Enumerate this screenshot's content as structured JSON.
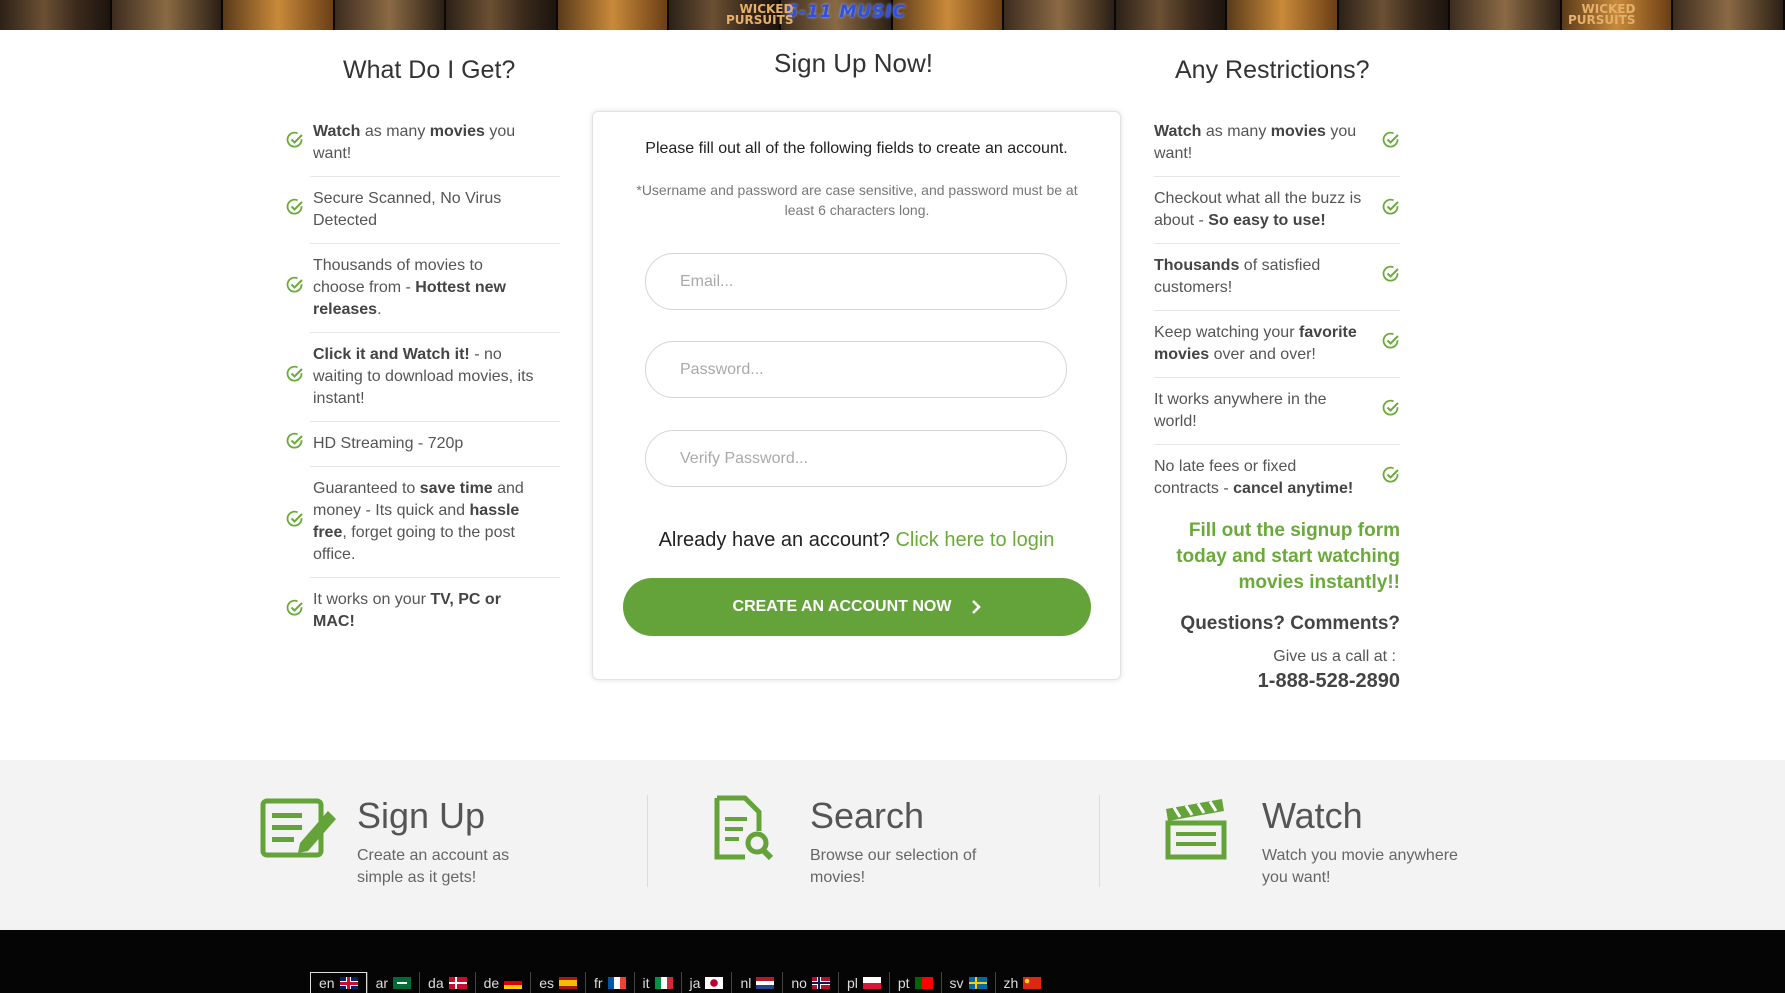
{
  "banner": {
    "logo": "5-11 MUSIC",
    "tag_left": "WICKED\nPURSUITS",
    "tag_right": "WICKED\nPURSUITS",
    "tiles": 16
  },
  "left": {
    "title": "What Do I Get?",
    "items": [
      {
        "html": "<b>Watch</b> as many <b>movies</b> you want!"
      },
      {
        "html": "Secure Scanned, No Virus Detected"
      },
      {
        "html": "Thousands of movies to choose from - <b>Hottest new releases</b>."
      },
      {
        "html": "<b>Click it and Watch it!</b> - no waiting to download movies, its instant!"
      },
      {
        "html": "HD Streaming - 720p"
      },
      {
        "html": "Guaranteed to <b>save time</b> and money - Its quick and <b>hassle free</b>, forget going to the post office."
      },
      {
        "html": "It works on your <b>TV, PC or MAC!</b>"
      }
    ]
  },
  "form": {
    "title": "Sign Up Now!",
    "intro": "Please fill out all of the following fields to create an account.",
    "note": "*Username and password are case sensitive, and password must be at least 6 characters long.",
    "email_placeholder": "Email...",
    "password_placeholder": "Password...",
    "verify_placeholder": "Verify Password...",
    "login_prompt": "Already have an account?",
    "login_link": "Click here to login",
    "cta_label": "CREATE AN ACCOUNT NOW",
    "cta_icon": "chevron-right-icon"
  },
  "right": {
    "title": "Any Restrictions?",
    "items": [
      {
        "html": "<b>Watch</b> as many <b>movies</b> you want!"
      },
      {
        "html": "Checkout what all the buzz is about - <b>So easy to use!</b>"
      },
      {
        "html": "<b>Thousands</b> of satisfied customers!"
      },
      {
        "html": "Keep watching your <b>favorite movies</b> over and over!"
      },
      {
        "html": "It works anywhere in the world!"
      },
      {
        "html": "No late fees or fixed contracts - <b>cancel anytime!</b>"
      }
    ],
    "promo": "Fill out the signup form today and start watching movies instantly!!",
    "questions_title": "Questions? Comments?",
    "call_label": "Give us a call at :",
    "phone": "1-888-528-2890"
  },
  "steps": [
    {
      "title": "Sign Up",
      "desc": "Create an account as simple as it gets!",
      "icon": "signup-form-icon"
    },
    {
      "title": "Search",
      "desc": "Browse our selection of movies!",
      "icon": "search-document-icon"
    },
    {
      "title": "Watch",
      "desc": "Watch you movie anywhere you want!",
      "icon": "clapperboard-icon"
    }
  ],
  "languages": [
    {
      "code": "en",
      "active": true
    },
    {
      "code": "ar"
    },
    {
      "code": "da"
    },
    {
      "code": "de"
    },
    {
      "code": "es"
    },
    {
      "code": "fr"
    },
    {
      "code": "it"
    },
    {
      "code": "ja"
    },
    {
      "code": "nl"
    },
    {
      "code": "no"
    },
    {
      "code": "pl"
    },
    {
      "code": "pt"
    },
    {
      "code": "sv"
    },
    {
      "code": "zh"
    }
  ],
  "colors": {
    "accent": "#64a33a",
    "accent_text": "#6aaa3a",
    "footer": "#050505",
    "band": "#f3f3f3"
  }
}
